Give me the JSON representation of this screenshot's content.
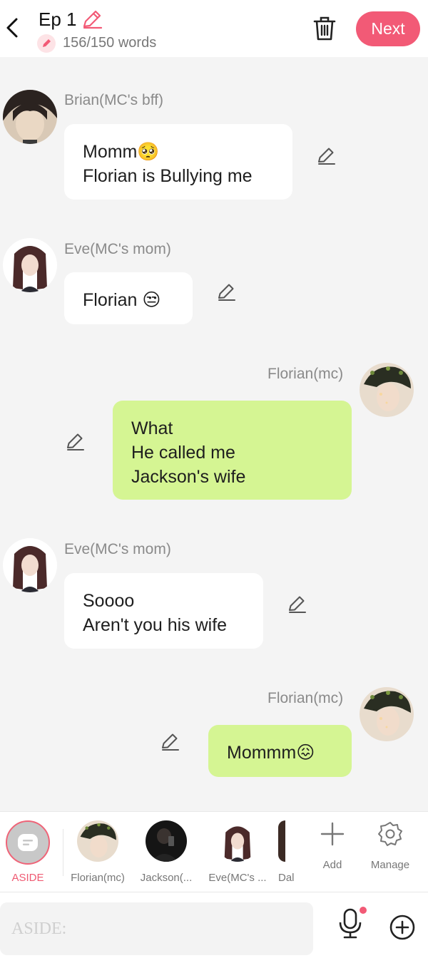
{
  "header": {
    "back_icon": "chevron-left-icon",
    "title": "Ep 1",
    "title_edit_icon": "pencil-icon",
    "word_count": "156/150 words",
    "delete_icon": "trash-icon",
    "next_label": "Next",
    "accent_color": "#f25a76"
  },
  "messages": [
    {
      "speaker": "Brian(MC's bff)",
      "side": "left",
      "lines": [
        "Momm🥺",
        "Florian is Bullying me"
      ]
    },
    {
      "speaker": "Eve(MC's mom)",
      "side": "left",
      "lines": [
        "Florian 😒"
      ]
    },
    {
      "speaker": "Florian(mc)",
      "side": "right",
      "lines": [
        "What",
        "He called me",
        "Jackson's wife"
      ]
    },
    {
      "speaker": "Eve(MC's mom)",
      "side": "left",
      "lines": [
        "Soooo",
        "Aren't you his wife"
      ]
    },
    {
      "speaker": "Florian(mc)",
      "side": "right",
      "lines": [
        "Mommm😖"
      ]
    }
  ],
  "characters": {
    "aside_label": "ASIDE",
    "items": [
      {
        "label": "Florian(mc)"
      },
      {
        "label": "Jackson(..."
      },
      {
        "label": "Eve(MC's ..."
      },
      {
        "label": "Dal"
      }
    ],
    "add_label": "Add",
    "manage_label": "Manage"
  },
  "input": {
    "placeholder": "ASIDE:",
    "mic_icon": "microphone-icon",
    "plus_icon": "plus-circle-icon"
  },
  "colors": {
    "bubble_green": "#d5f593",
    "bubble_white": "#ffffff",
    "background": "#f4f4f4"
  }
}
